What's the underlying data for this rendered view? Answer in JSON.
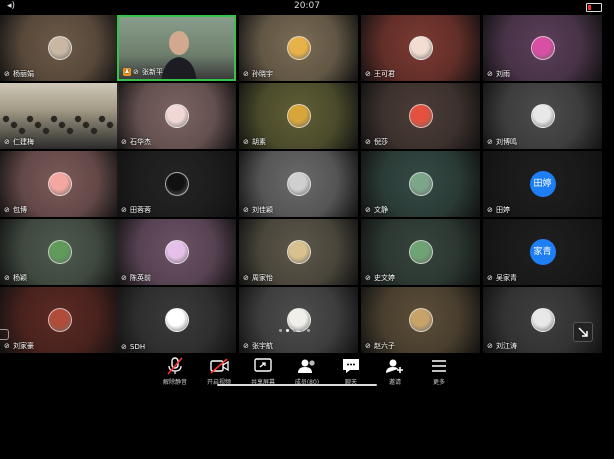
{
  "status_bar": {
    "time": "20:07"
  },
  "participants": [
    {
      "name": "杨丽娟",
      "bg": "#6d5a48",
      "av": "#c9b7a3",
      "type": "avatar"
    },
    {
      "name": "张新平",
      "bg": "#7c8a76",
      "av": "",
      "type": "video",
      "host": true,
      "active": true
    },
    {
      "name": "孙晓宇",
      "bg": "#7a6c55",
      "av": "#e8b24a",
      "type": "avatar"
    },
    {
      "name": "王可君",
      "bg": "#7b3a32",
      "av": "#f2ddd0",
      "type": "avatar"
    },
    {
      "name": "刘雨",
      "bg": "#5a3f59",
      "av": "#d94fa4",
      "type": "avatar"
    },
    {
      "name": "仁建梅",
      "bg": "#8f8b80",
      "av": "",
      "type": "classroom"
    },
    {
      "name": "石华杰",
      "bg": "#7c6462",
      "av": "#f1d8d4",
      "type": "avatar"
    },
    {
      "name": "胡素",
      "bg": "#5e5e36",
      "av": "#d8a53b",
      "type": "avatar"
    },
    {
      "name": "倪莎",
      "bg": "#4b3d38",
      "av": "#e4523f",
      "type": "avatar"
    },
    {
      "name": "刘博鸣",
      "bg": "#4c4c4c",
      "av": "#e8e8e8",
      "type": "avatar"
    },
    {
      "name": "包博",
      "bg": "#7b5a59",
      "av": "#f4a7a0",
      "type": "avatar"
    },
    {
      "name": "田蓉蓉",
      "bg": "#242424",
      "av": "#111111",
      "type": "avatar"
    },
    {
      "name": "刘佳颖",
      "bg": "#6a6a6a",
      "av": "#cfcfcf",
      "type": "avatar"
    },
    {
      "name": "文静",
      "bg": "#354a44",
      "av": "#7ca589",
      "type": "avatar"
    },
    {
      "name": "田婷",
      "bg": "#1f1f1f",
      "av": "田婷",
      "type": "text"
    },
    {
      "name": "杨颖",
      "bg": "#4e5a4e",
      "av": "#5f9b5a",
      "type": "avatar"
    },
    {
      "name": "陈英前",
      "bg": "#6c5266",
      "av": "#e6c0e8",
      "type": "avatar"
    },
    {
      "name": "周家怡",
      "bg": "#5c574a",
      "av": "#d9c18f",
      "type": "avatar"
    },
    {
      "name": "史文婷",
      "bg": "#36443c",
      "av": "#6fa374",
      "type": "avatar"
    },
    {
      "name": "吴家青",
      "bg": "#1f1f1f",
      "av": "家青",
      "type": "text"
    },
    {
      "name": "刘家豪",
      "bg": "#5b2a24",
      "av": "#b24c3a",
      "type": "avatar"
    },
    {
      "name": "SDH",
      "bg": "#3a3a3a",
      "av": "#ffffff",
      "type": "avatar"
    },
    {
      "name": "张宇航",
      "bg": "#4d4d4d",
      "av": "#f0efe9",
      "type": "avatar"
    },
    {
      "name": "赵六子",
      "bg": "#5b4e39",
      "av": "#c7a36a",
      "type": "avatar"
    },
    {
      "name": "刘江涛",
      "bg": "#3f3f3f",
      "av": "#e8e8e8",
      "type": "avatar"
    }
  ],
  "toolbar": [
    {
      "label": "解除静音",
      "icon": "mic-muted-icon"
    },
    {
      "label": "开启视频",
      "icon": "video-off-icon"
    },
    {
      "label": "共享屏幕",
      "icon": "share-screen-icon"
    },
    {
      "label": "成员(80)",
      "icon": "members-icon"
    },
    {
      "label": "聊天",
      "icon": "chat-icon"
    },
    {
      "label": "邀请",
      "icon": "invite-icon"
    },
    {
      "label": "更多",
      "icon": "more-icon"
    }
  ]
}
